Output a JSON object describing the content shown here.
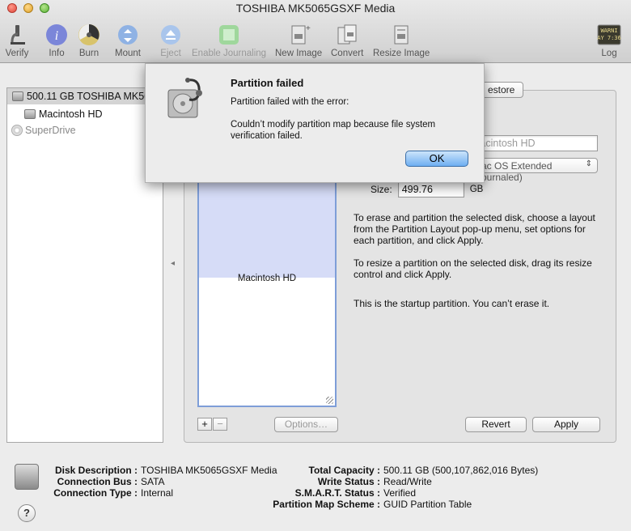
{
  "window": {
    "title": "TOSHIBA MK5065GSXF Media"
  },
  "toolbar": {
    "verify": "Verify",
    "info": "Info",
    "burn": "Burn",
    "mount": "Mount",
    "eject": "Eject",
    "enable_journaling": "Enable Journaling",
    "new_image": "New Image",
    "convert": "Convert",
    "resize_image": "Resize Image",
    "log": "Log",
    "log_icon_text": "WARNI\nAY 7:36"
  },
  "sidebar": {
    "items": [
      {
        "label": "500.11 GB TOSHIBA MK5065GSXF Media",
        "selected": true
      },
      {
        "label": "Macintosh HD"
      },
      {
        "label": "SuperDrive"
      }
    ]
  },
  "tabs": {
    "restore": "estore"
  },
  "partition": {
    "layout_label": "Macintosh HD",
    "name_value": "Macintosh HD",
    "format_value": "Mac OS Extended (Journaled)",
    "size_label": "Size:",
    "size_value": "499.76",
    "size_unit": "GB",
    "help1": "To erase and partition the selected disk, choose a layout from the Partition Layout pop-up menu, set options for each partition, and click Apply.",
    "help2": "To resize a partition on the selected disk, drag its resize control and click Apply.",
    "help3": "This is the startup partition. You can’t erase it.",
    "add": "+",
    "remove": "−",
    "options": "Options…",
    "revert": "Revert",
    "apply": "Apply"
  },
  "info": {
    "disk_description_label": "Disk Description :",
    "disk_description": "TOSHIBA MK5065GSXF Media",
    "connection_bus_label": "Connection Bus :",
    "connection_bus": "SATA",
    "connection_type_label": "Connection Type :",
    "connection_type": "Internal",
    "total_capacity_label": "Total Capacity :",
    "total_capacity": "500.11 GB (500,107,862,016 Bytes)",
    "write_status_label": "Write Status :",
    "write_status": "Read/Write",
    "smart_status_label": "S.M.A.R.T. Status :",
    "smart_status": "Verified",
    "partition_map_label": "Partition Map Scheme :",
    "partition_map": "GUID Partition Table",
    "help": "?"
  },
  "dialog": {
    "title": "Partition failed",
    "message": "Partition failed with the error:",
    "detail": "Couldn’t modify partition map because file system verification failed.",
    "ok": "OK"
  },
  "colors": {
    "accent": "#6eaef1",
    "selection": "#d4d4d4",
    "layout_fill": "#d6dcf7"
  }
}
